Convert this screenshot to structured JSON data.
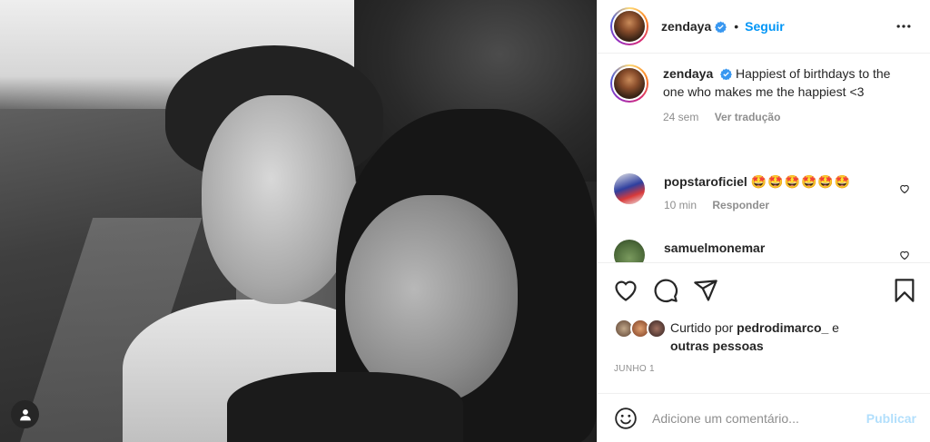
{
  "header": {
    "username": "zendaya",
    "separator": "•",
    "follow_label": "Seguir",
    "more_icon": "more-horizontal-icon"
  },
  "caption": {
    "username": "zendaya",
    "text": "Happiest of birthdays to the one who makes me the happiest <3",
    "age": "24 sem",
    "translate_label": "Ver tradução"
  },
  "comments": [
    {
      "username": "popstaroficiel",
      "text": "🤩🤩🤩🤩🤩🤩",
      "age": "10 min",
      "reply_label": "Responder"
    },
    {
      "username": "samuelmonemar"
    }
  ],
  "likes": {
    "prefix": "Curtido por ",
    "username": "pedrodimarco_",
    "suffix": " e ",
    "others": "outras pessoas"
  },
  "date": "JUNHO 1",
  "add_comment": {
    "placeholder": "Adicione um comentário...",
    "publish_label": "Publicar"
  },
  "colors": {
    "accent": "#0095f6",
    "publish_disabled": "#b2dffc",
    "muted": "#8e8e8e",
    "text": "#262626"
  }
}
